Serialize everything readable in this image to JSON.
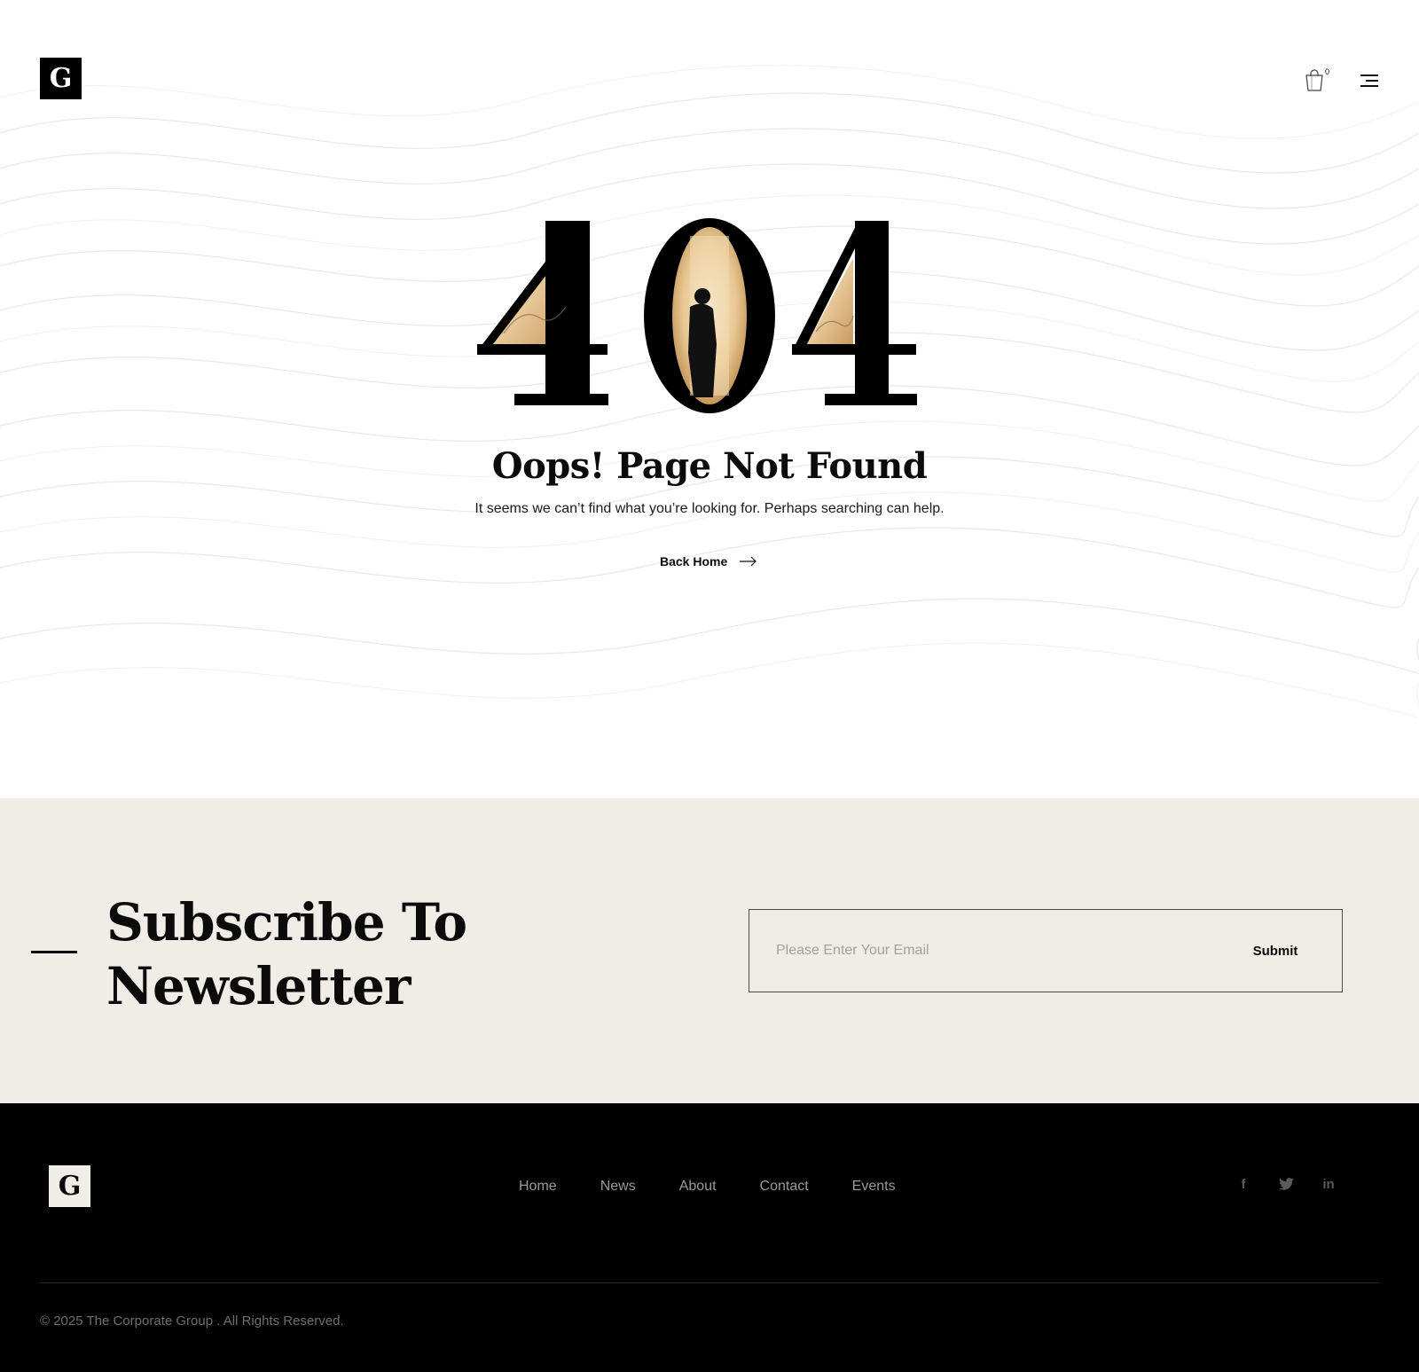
{
  "header": {
    "logo_letter": "G",
    "cart_count": "0",
    "cart_icon": "shopping-bag-icon",
    "menu_icon": "hamburger-menu-icon"
  },
  "error": {
    "code": "404",
    "heading": "Oops! Page Not Found",
    "message": "It seems we can’t find what you’re looking for. Perhaps searching can help.",
    "back_label": "Back Home",
    "back_icon": "arrow-right-icon"
  },
  "newsletter": {
    "title_line1": "Subscribe To",
    "title_line2": "Newsletter",
    "email_placeholder": "Please Enter Your Email",
    "submit_label": "Submit"
  },
  "footer": {
    "logo_letter": "G",
    "nav": [
      "Home",
      "News",
      "About",
      "Contact",
      "Events"
    ],
    "social": [
      {
        "icon": "facebook-icon",
        "glyph": "f"
      },
      {
        "icon": "twitter-icon",
        "glyph": ""
      },
      {
        "icon": "linkedin-icon",
        "glyph": "in"
      }
    ],
    "copyright": "© 2025 The Corporate Group . All Rights Reserved."
  },
  "colors": {
    "accent_bg": "#f0ede6",
    "text": "#0b0b0b",
    "footer_bg": "#000000"
  }
}
